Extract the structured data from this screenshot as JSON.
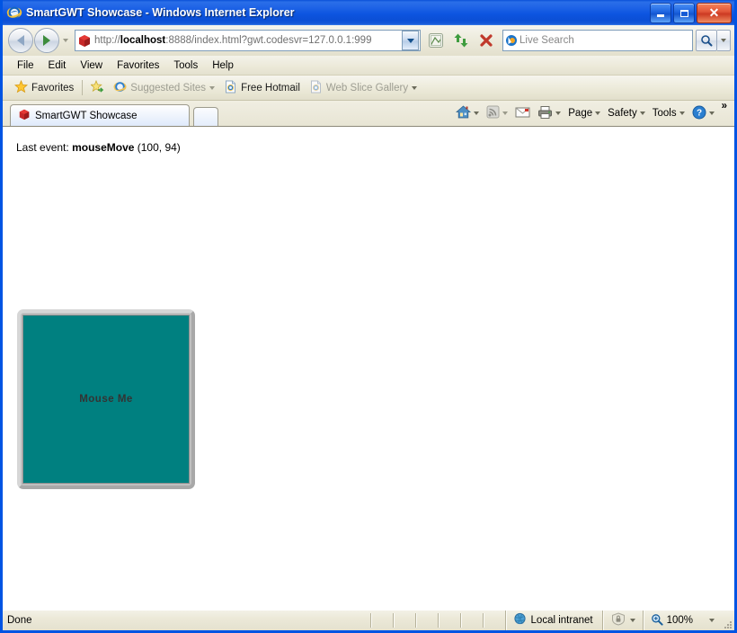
{
  "window": {
    "title": "SmartGWT Showcase - Windows Internet Explorer",
    "icon": "internet-explorer-icon",
    "buttons": {
      "minimize": "Minimize",
      "maximize": "Maximize",
      "close": "Close"
    }
  },
  "navbar": {
    "back_label": "Back",
    "forward_label": "Forward",
    "recent_pages_label": "Recent Pages",
    "address": {
      "icon": "red-box-icon",
      "url_prefix": "http://",
      "url_host": "localhost",
      "url_rest": ":8888/index.html?gwt.codesvr=127.0.0.1:999",
      "url_full": "http://localhost:8888/index.html?gwt.codesvr=127.0.0.1:999",
      "dropdown_label": "Address dropdown"
    },
    "compat_view_label": "Compatibility View",
    "refresh_label": "Refresh",
    "stop_label": "Stop",
    "search": {
      "placeholder": "Live Search",
      "provider_icon": "bing-icon",
      "go_label": "Search",
      "dropdown_label": "Search options"
    }
  },
  "menubar": {
    "items": [
      {
        "label": "File"
      },
      {
        "label": "Edit"
      },
      {
        "label": "View"
      },
      {
        "label": "Favorites"
      },
      {
        "label": "Tools"
      },
      {
        "label": "Help"
      }
    ]
  },
  "favbar": {
    "favorites_label": "Favorites",
    "add_label": "Add to Favorites Bar",
    "items": [
      {
        "label": "Suggested Sites",
        "icon": "ie-icon",
        "dimmed": true,
        "has_dropdown": true
      },
      {
        "label": "Free Hotmail",
        "icon": "page-icon",
        "dimmed": false,
        "has_dropdown": false
      },
      {
        "label": "Web Slice Gallery",
        "icon": "page-icon",
        "dimmed": true,
        "has_dropdown": true
      }
    ]
  },
  "tabbar": {
    "tabs": [
      {
        "label": "SmartGWT Showcase",
        "icon": "red-box-icon",
        "active": true
      }
    ],
    "new_tab_label": "New Tab"
  },
  "cmdbar": {
    "items": [
      {
        "label": "",
        "icon": "home-icon",
        "has_dropdown": true
      },
      {
        "label": "",
        "icon": "feeds-icon",
        "has_dropdown": true,
        "dimmed": true
      },
      {
        "label": "",
        "icon": "mail-icon",
        "has_dropdown": false
      },
      {
        "label": "",
        "icon": "print-icon",
        "has_dropdown": true
      },
      {
        "label": "Page",
        "icon": "",
        "has_dropdown": true
      },
      {
        "label": "Safety",
        "icon": "",
        "has_dropdown": true
      },
      {
        "label": "Tools",
        "icon": "",
        "has_dropdown": true
      },
      {
        "label": "",
        "icon": "help-icon",
        "has_dropdown": true
      }
    ],
    "overflow_label": "»"
  },
  "page": {
    "last_event": {
      "prefix": "Last event:",
      "event_name": "mouseMove",
      "coords": "(100, 94)"
    },
    "canvas": {
      "label": "Mouse Me",
      "fill_color": "#008080",
      "border_color": "#bfbfbf",
      "text_color": "#333333"
    }
  },
  "statusbar": {
    "status": "Done",
    "zone": "Local intranet",
    "zone_icon": "globe-icon",
    "protected_icon": "protected-mode-icon",
    "protected_dropdown": "Protected mode options",
    "zoom_icon": "zoom-icon",
    "zoom_level": "100%",
    "zoom_dropdown": "Change zoom level"
  }
}
